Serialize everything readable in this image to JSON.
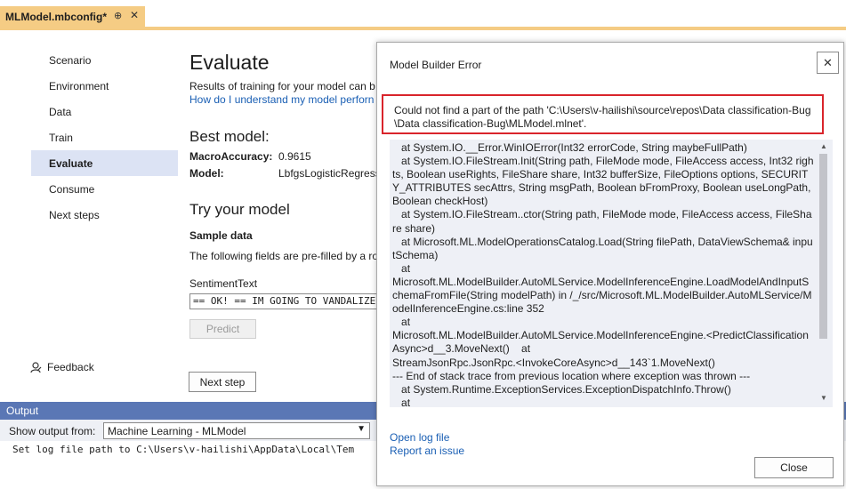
{
  "tab": {
    "title": "MLModel.mbconfig*",
    "pin_glyph": "⊕",
    "close_glyph": "✕",
    "accent": "#f5cc84"
  },
  "nav": {
    "items": [
      {
        "label": "Scenario",
        "active": false
      },
      {
        "label": "Environment",
        "active": false
      },
      {
        "label": "Data",
        "active": false
      },
      {
        "label": "Train",
        "active": false
      },
      {
        "label": "Evaluate",
        "active": true
      },
      {
        "label": "Consume",
        "active": false
      },
      {
        "label": "Next steps",
        "active": false
      }
    ],
    "feedback_label": "Feedback"
  },
  "evaluate": {
    "title": "Evaluate",
    "results_text": "Results of training for your model can b",
    "how_link": "How do I understand my model perforn",
    "best_model_heading": "Best model:",
    "macro_accuracy_label": "MacroAccuracy:",
    "macro_accuracy_value": "0.9615",
    "model_label": "Model:",
    "model_value": "LbfgsLogisticRegress",
    "try_heading": "Try your model",
    "sample_heading": "Sample data",
    "sample_desc": "The following fields are pre-filled by a ro",
    "sentiment_label": "SentimentText",
    "sentiment_value": "== OK! ==  IM GOING TO VANDALIZE W",
    "predict_label": "Predict",
    "next_step_label": "Next step"
  },
  "output": {
    "header": "Output",
    "show_from_label": "Show output from:",
    "selected_source": "Machine Learning - MLModel",
    "text": "Set log file path to C:\\Users\\v-hailishi\\AppData\\Local\\Tem"
  },
  "dialog": {
    "title": "Model Builder Error",
    "close_glyph": "✕",
    "error_line1": "Could not find a part of the path 'C:\\Users\\v-hailishi\\source\\repos\\Data classification-Bug",
    "error_line2": "\\Data classification-Bug\\MLModel.mlnet'.",
    "stack_trace": "   at System.IO.__Error.WinIOError(Int32 errorCode, String maybeFullPath)\n   at System.IO.FileStream.Init(String path, FileMode mode, FileAccess access, Int32 rights, Boolean useRights, FileShare share, Int32 bufferSize, FileOptions options, SECURITY_ATTRIBUTES secAttrs, String msgPath, Boolean bFromProxy, Boolean useLongPath, Boolean checkHost)\n   at System.IO.FileStream..ctor(String path, FileMode mode, FileAccess access, FileShare share)\n   at Microsoft.ML.ModelOperationsCatalog.Load(String filePath, DataViewSchema& inputSchema)\n   at\nMicrosoft.ML.ModelBuilder.AutoMLService.ModelInferenceEngine.LoadModelAndInputSchemaFromFile(String modelPath) in /_/src/Microsoft.ML.ModelBuilder.AutoMLService/ModelInferenceEngine.cs:line 352\n   at\nMicrosoft.ML.ModelBuilder.AutoMLService.ModelInferenceEngine.<PredictClassificationAsync>d__3.MoveNext()    at\nStreamJsonRpc.JsonRpc.<InvokeCoreAsync>d__143`1.MoveNext()\n--- End of stack trace from previous location where exception was thrown ---\n   at System.Runtime.ExceptionServices.ExceptionDispatchInfo.Throw()\n   at",
    "open_log_link": "Open log file",
    "report_issue_link": "Report an issue",
    "close_button": "Close",
    "error_border_color": "#d9242b"
  }
}
